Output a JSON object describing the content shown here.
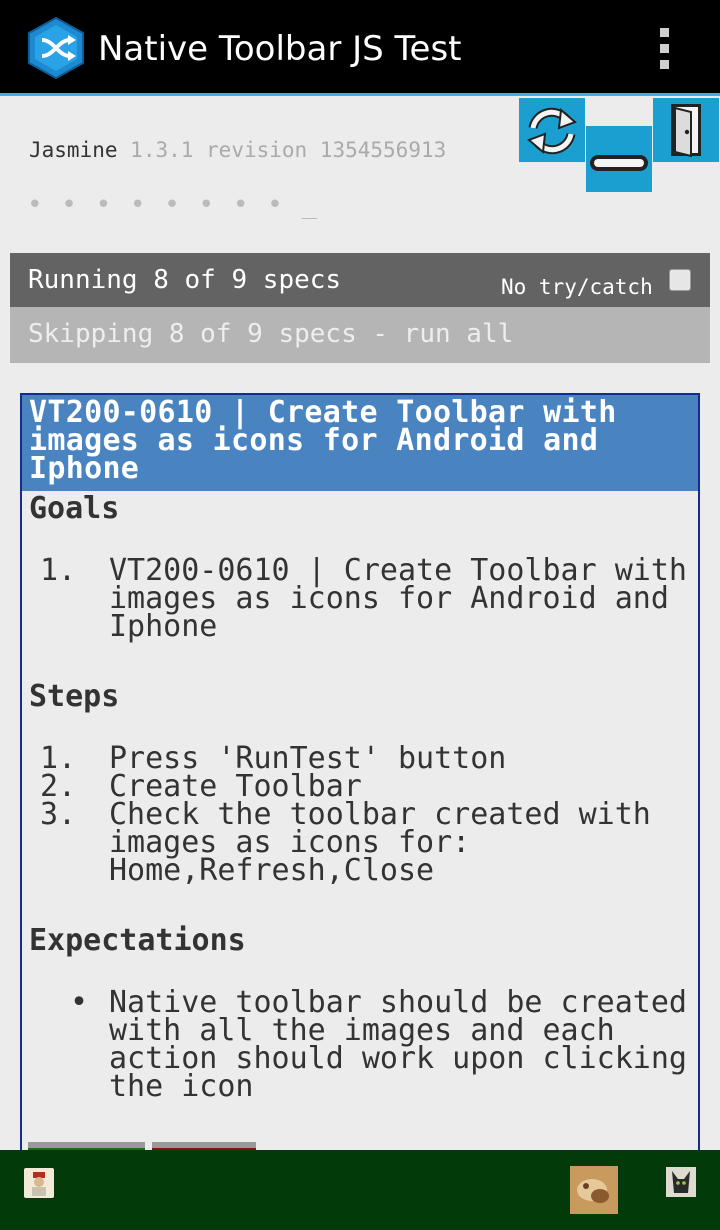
{
  "app": {
    "title": "Native Toolbar JS Test",
    "icon": "shuffle-icon",
    "overflow_icon": "overflow-menu-icon"
  },
  "jasmine": {
    "name": "Jasmine",
    "version": "1.3.1 revision 1354556913",
    "progress": "• • • • • • • • _"
  },
  "toolbar_images": [
    "refresh-icon",
    "minimize-icon",
    "door-exit-icon"
  ],
  "runner": {
    "running": "Running 8 of 9 specs",
    "no_try_catch": "No try/catch",
    "skipping": "Skipping 8 of 9 specs - run all"
  },
  "test": {
    "title": "VT200-0610 | Create Toolbar with images as icons for Android and Iphone",
    "goals_heading": "Goals",
    "goals": [
      "VT200-0610 | Create Toolbar with images as icons for Android and Iphone"
    ],
    "steps_heading": "Steps",
    "steps": [
      "Press 'RunTest' button",
      "Create Toolbar",
      "Check the toolbar created with images as icons for: Home,Refresh,Close"
    ],
    "expectations_heading": "Expectations",
    "expectations": [
      "Native toolbar should be created with all the images and each action should work upon clicking the icon"
    ]
  },
  "bottom_toolbar": [
    "home-image-icon",
    "refresh-image-icon",
    "close-image-icon"
  ],
  "colors": {
    "accent": "#33b5e5",
    "card_header": "#4a84c0",
    "bottom_bar": "#023a0a",
    "toolbar_button": "#1a9fd0"
  }
}
